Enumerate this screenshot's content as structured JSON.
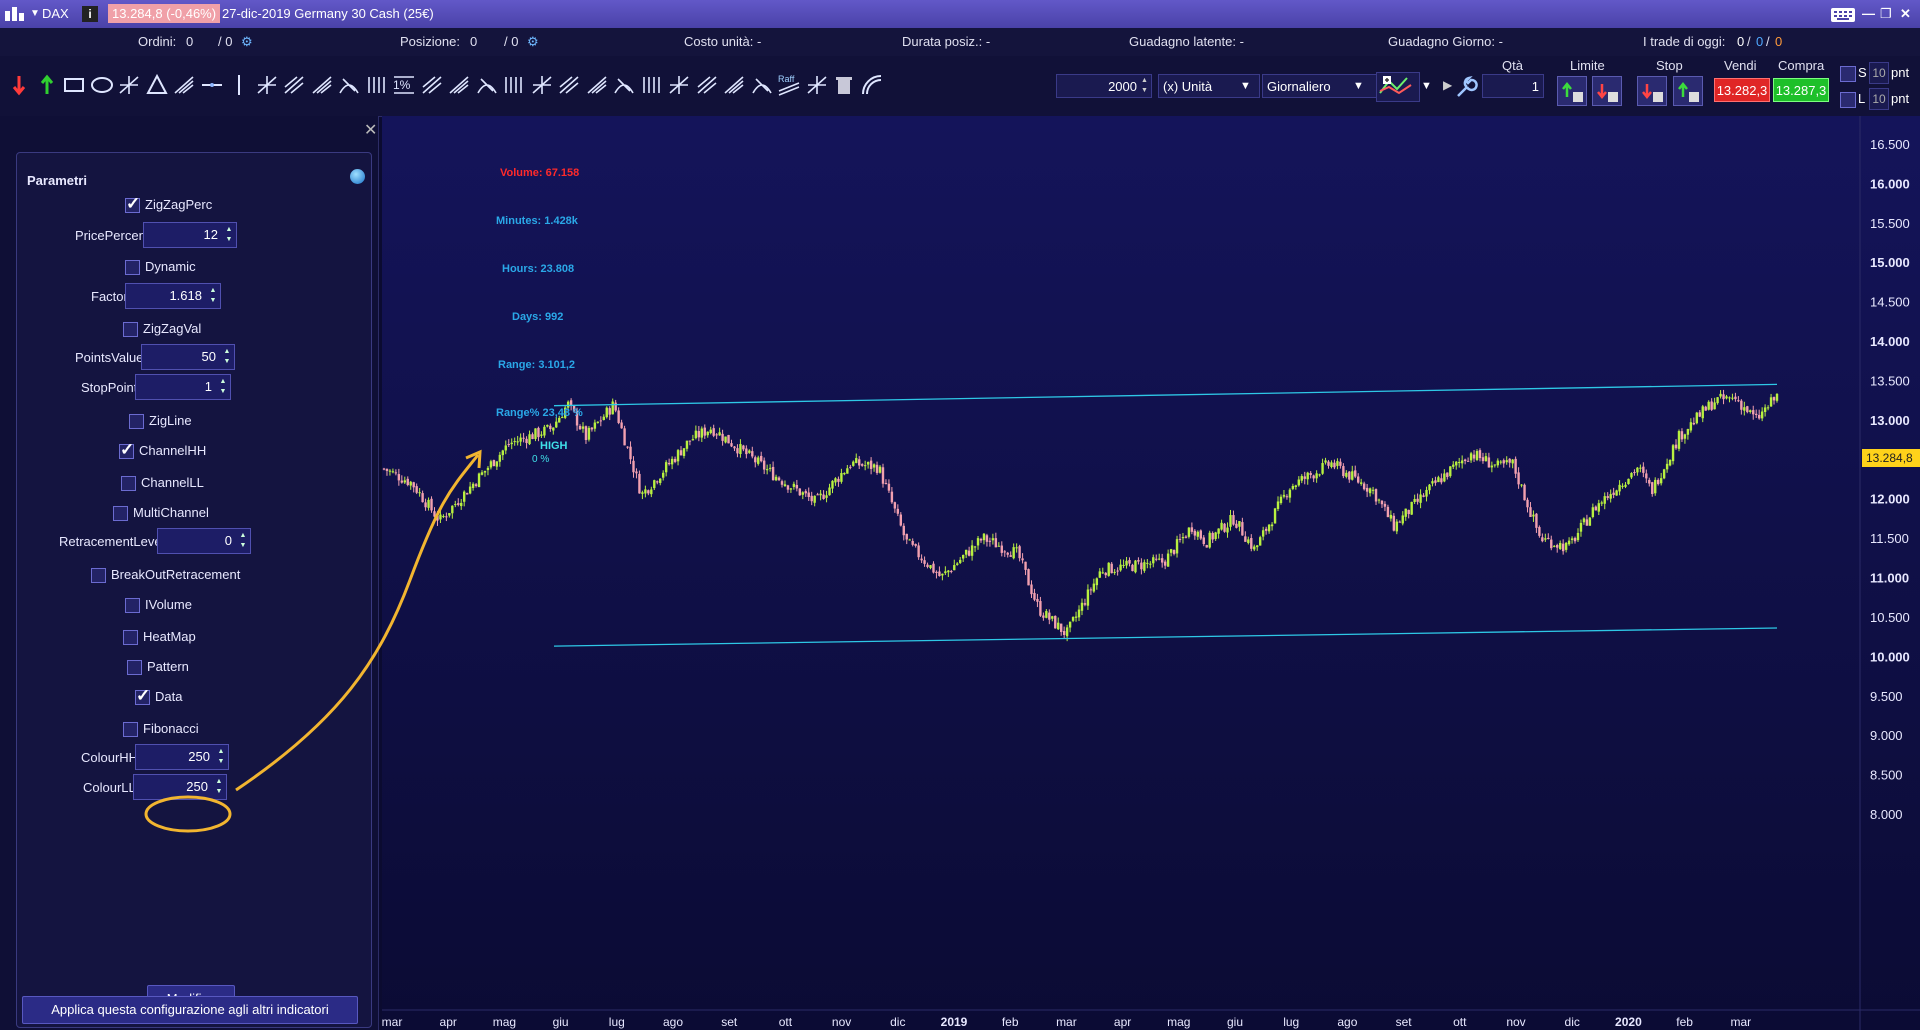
{
  "window": {
    "symbol": "DAX",
    "price_badge": "13.284,8 (-0,46%)",
    "title": "27-dic-2019 Germany 30 Cash (25€)"
  },
  "infobar": {
    "ordini_label": "Ordini:",
    "ordini_val": "0",
    "ordini_sep": "/ 0",
    "posizione_label": "Posizione:",
    "posizione_val": "0",
    "posizione_sep": "/ 0",
    "costo": "Costo unità: -",
    "durata": "Durata posiz.: -",
    "guadagno_latente": "Guadagno latente: -",
    "guadagno_giorno": "Guadagno Giorno: -",
    "trade_label": "I trade di oggi:",
    "trade_a": "0",
    "trade_b": "0",
    "trade_c": "0"
  },
  "toolbar": {
    "quantity_value": "2000",
    "unit_select": "(x) Unità",
    "period_select": "Giornaliero",
    "qta_label": "Qtà",
    "qta_value": "1",
    "limite_label": "Limite",
    "stop_label": "Stop",
    "vendi_label": "Vendi",
    "compra_label": "Compra",
    "vendi_price": "13.282,3",
    "compra_price": "13.287,3",
    "side_s": "S",
    "side_l": "L",
    "pnt_val_s": "10",
    "pnt_val_l": "10",
    "pnt_label_s": "pnt",
    "pnt_label_l": "pnt",
    "raff_label": "Raff",
    "fib_label": "1%"
  },
  "panel": {
    "title": "Parametri",
    "params": [
      {
        "type": "check",
        "label": "ZigZagPerc",
        "checked": true
      },
      {
        "type": "input",
        "label": "PricePercent",
        "value": "12"
      },
      {
        "type": "check",
        "label": "Dynamic",
        "checked": false
      },
      {
        "type": "input",
        "label": "Factor",
        "value": "1.618"
      },
      {
        "type": "check",
        "label": "ZigZagVal",
        "checked": false
      },
      {
        "type": "input",
        "label": "PointsValue",
        "value": "50"
      },
      {
        "type": "input",
        "label": "StopPoint",
        "value": "1"
      },
      {
        "type": "check",
        "label": "ZigLine",
        "checked": false
      },
      {
        "type": "check",
        "label": "ChannelHH",
        "checked": true
      },
      {
        "type": "check",
        "label": "ChannelLL",
        "checked": false
      },
      {
        "type": "check",
        "label": "MultiChannel",
        "checked": false
      },
      {
        "type": "input",
        "label": "RetracementLevel",
        "value": "0"
      },
      {
        "type": "check",
        "label": "BreakOutRetracement",
        "checked": false
      },
      {
        "type": "check",
        "label": "IVolume",
        "checked": false
      },
      {
        "type": "check",
        "label": "HeatMap",
        "checked": false
      },
      {
        "type": "check",
        "label": "Pattern",
        "checked": false
      },
      {
        "type": "check",
        "label": "Data",
        "checked": true
      },
      {
        "type": "check",
        "label": "Fibonacci",
        "checked": false
      },
      {
        "type": "input",
        "label": "ColourHH",
        "value": "250"
      },
      {
        "type": "input",
        "label": "ColourLL",
        "value": "250"
      }
    ],
    "modify_button": "Modifica",
    "apply_button": "Applica questa configurazione agli altri indicatori",
    "annotation_color": "#f2b530"
  },
  "chart_data": {
    "type": "candlestick",
    "x_ticks": [
      "mar",
      "apr",
      "mag",
      "giu",
      "lug",
      "ago",
      "set",
      "ott",
      "nov",
      "dic",
      "2019",
      "feb",
      "mar",
      "apr",
      "mag",
      "giu",
      "lug",
      "ago",
      "set",
      "ott",
      "nov",
      "dic",
      "2020",
      "feb",
      "mar"
    ],
    "y_ticks": [
      "16.500",
      "16.000",
      "15.500",
      "15.000",
      "14.500",
      "14.000",
      "13.500",
      "13.000",
      "12.500",
      "12.000",
      "11.500",
      "11.000",
      "10.500",
      "10.000",
      "9.500",
      "9.000",
      "8.500",
      "8.000"
    ],
    "ylim": [
      7500,
      16800
    ],
    "last_price": "13.284,8",
    "stats": [
      {
        "text": "Volume: 67.158",
        "color": "#ff2a2a"
      },
      {
        "text": "Minutes: 1.428k",
        "color": "#2aa8e8"
      },
      {
        "text": "Hours: 23.808",
        "color": "#2aa8e8"
      },
      {
        "text": "Days: 992",
        "color": "#2aa8e8"
      },
      {
        "text": "Range: 3.101,2",
        "color": "#2aa8e8"
      },
      {
        "text": "Range% 23,48 %",
        "color": "#2aa8e8"
      }
    ],
    "high_label": "HIGH",
    "high_pct": "0 %",
    "path": [
      [
        0,
        12380
      ],
      [
        0.02,
        12200
      ],
      [
        0.04,
        11720
      ],
      [
        0.09,
        12700
      ],
      [
        0.12,
        12890
      ],
      [
        0.132,
        13200
      ],
      [
        0.145,
        12780
      ],
      [
        0.165,
        13200
      ],
      [
        0.185,
        12050
      ],
      [
        0.22,
        12750
      ],
      [
        0.235,
        12900
      ],
      [
        0.28,
        12300
      ],
      [
        0.31,
        11950
      ],
      [
        0.335,
        12450
      ],
      [
        0.355,
        12400
      ],
      [
        0.375,
        11450
      ],
      [
        0.4,
        11000
      ],
      [
        0.43,
        11500
      ],
      [
        0.455,
        11300
      ],
      [
        0.47,
        10600
      ],
      [
        0.49,
        10280
      ],
      [
        0.515,
        11100
      ],
      [
        0.56,
        11200
      ],
      [
        0.58,
        11650
      ],
      [
        0.59,
        11450
      ],
      [
        0.61,
        11750
      ],
      [
        0.625,
        11350
      ],
      [
        0.65,
        12150
      ],
      [
        0.68,
        12450
      ],
      [
        0.71,
        12100
      ],
      [
        0.725,
        11650
      ],
      [
        0.755,
        12200
      ],
      [
        0.78,
        12580
      ],
      [
        0.8,
        12400
      ],
      [
        0.81,
        12450
      ],
      [
        0.83,
        11500
      ],
      [
        0.85,
        11380
      ],
      [
        0.87,
        11900
      ],
      [
        0.9,
        12400
      ],
      [
        0.91,
        12100
      ],
      [
        0.93,
        12800
      ],
      [
        0.955,
        13240
      ],
      [
        0.97,
        13280
      ],
      [
        0.985,
        13000
      ],
      [
        1.0,
        13300
      ]
    ],
    "channel": {
      "upper_start": 13180,
      "upper_end": 13450,
      "lower_start": 10130,
      "lower_end": 10360
    }
  }
}
